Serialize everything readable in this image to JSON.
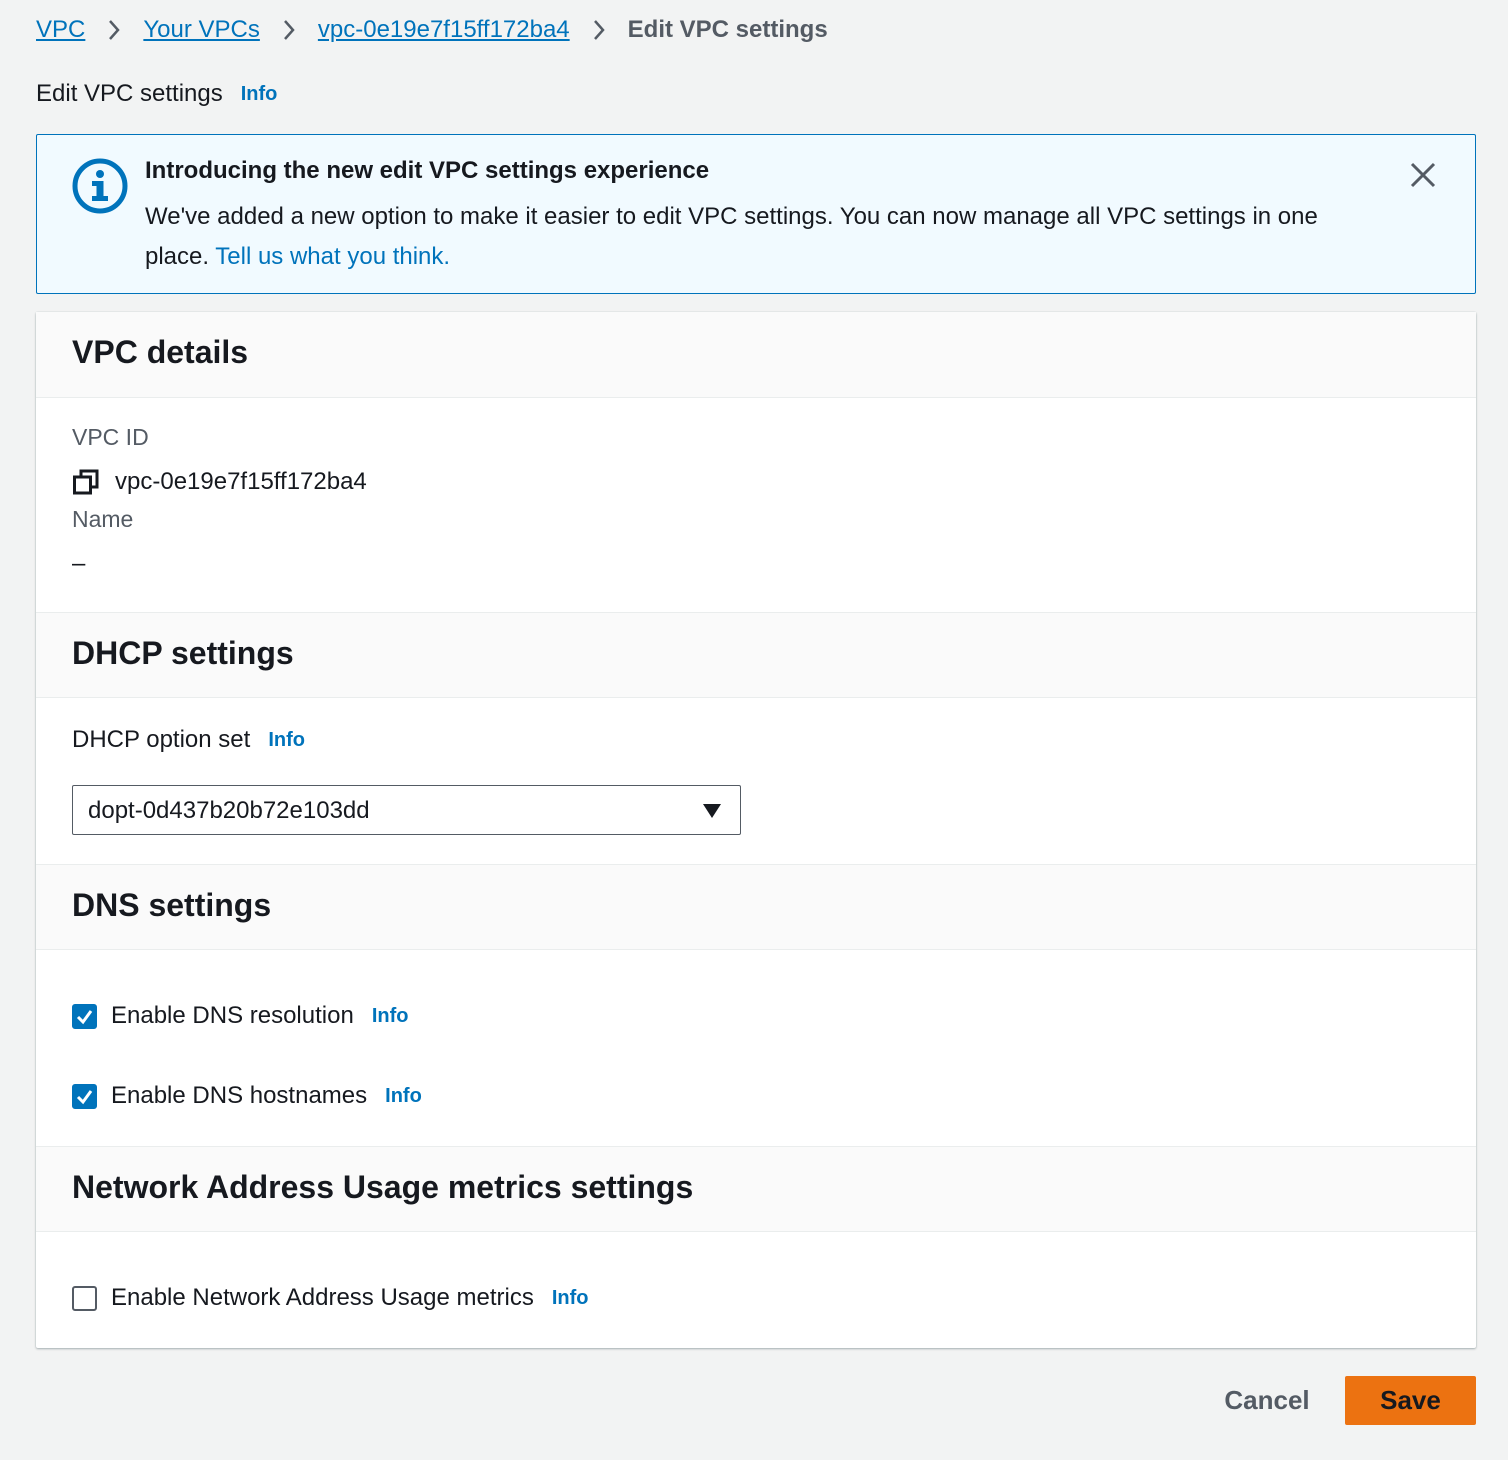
{
  "breadcrumb": {
    "items": [
      "VPC",
      "Your VPCs",
      "vpc-0e19e7f15ff172ba4"
    ],
    "current": "Edit VPC settings"
  },
  "page": {
    "title": "Edit VPC settings",
    "info_label": "Info"
  },
  "flash": {
    "title": "Introducing the new edit VPC settings experience",
    "body": "We've added a new option to make it easier to edit VPC settings. You can now manage all VPC settings in one place.",
    "link": "Tell us what you think."
  },
  "vpc_details": {
    "heading": "VPC details",
    "vpc_id_label": "VPC ID",
    "vpc_id_value": "vpc-0e19e7f15ff172ba4",
    "name_label": "Name",
    "name_value": "–"
  },
  "dhcp": {
    "heading": "DHCP settings",
    "option_set_label": "DHCP option set",
    "info_label": "Info",
    "selected_value": "dopt-0d437b20b72e103dd"
  },
  "dns": {
    "heading": "DNS settings",
    "resolution_label": "Enable DNS resolution",
    "resolution_checked": true,
    "hostnames_label": "Enable DNS hostnames",
    "hostnames_checked": true,
    "info_label": "Info"
  },
  "nau": {
    "heading": "Network Address Usage metrics settings",
    "metrics_label": "Enable Network Address Usage metrics",
    "metrics_checked": false,
    "info_label": "Info"
  },
  "actions": {
    "cancel_label": "Cancel",
    "save_label": "Save"
  },
  "icons": {
    "flash": "info-circle-icon",
    "close": "close-icon",
    "copy": "copy-icon",
    "caret": "caret-down-icon",
    "separator": "chevron-right-icon",
    "check": "checkmark-icon"
  },
  "colors": {
    "link": "#0073bb",
    "primary_button": "#ec7211",
    "flash_background": "#f1faff",
    "checkbox_checked": "#0073bb"
  }
}
